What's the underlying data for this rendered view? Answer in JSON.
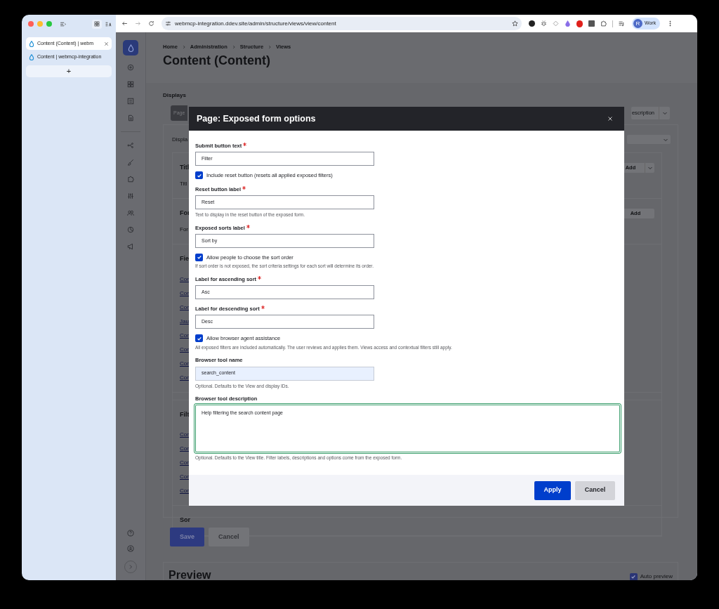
{
  "browser": {
    "tabs": [
      {
        "title": "Content (Content) | webm",
        "selected": true
      },
      {
        "title": "Content | webmcp-integration",
        "selected": false
      }
    ],
    "new_tab": "+",
    "url": "webmcp-integration.ddev.site/admin/structure/views/view/content",
    "profile": {
      "initial": "R",
      "name": "Work"
    }
  },
  "page": {
    "breadcrumb": [
      "Home",
      "Administration",
      "Structure",
      "Views"
    ],
    "title": "Content (Content)",
    "displays_label": "Displays",
    "display_tab": "Page",
    "description_button": "escription",
    "display_label": "Displa",
    "sections": [
      {
        "heading": "Titl",
        "lines": [
          "Titl"
        ],
        "button": {
          "label": "Add",
          "dropdown": true
        }
      },
      {
        "heading": "For",
        "lines": [
          "For"
        ],
        "button": {
          "label": "Add",
          "dropdown": false
        }
      },
      {
        "heading": "Fie",
        "links": [
          "Con",
          "Con",
          "Con",
          "Jau",
          "Con",
          "Con",
          "Con",
          "Con"
        ]
      },
      {
        "heading": "Filt",
        "links": [
          "Con",
          "Con",
          "Con",
          "Con",
          "Con"
        ]
      },
      {
        "heading": "Sor"
      }
    ],
    "buttons": [
      {
        "label": "Save",
        "kind": "primary"
      },
      {
        "label": "Cancel",
        "kind": "secondary"
      }
    ],
    "preview": "Preview",
    "auto_preview": {
      "label": "Auto preview",
      "checked": true
    }
  },
  "dialog": {
    "title": "Page: Exposed form options",
    "fields": [
      {
        "kind": "text",
        "label": "Submit button text",
        "required": true,
        "value": "Filter"
      },
      {
        "kind": "checkbox",
        "label": "Include reset button (resets all applied exposed filters)",
        "checked": true
      },
      {
        "kind": "text",
        "label": "Reset button label",
        "required": true,
        "value": "Reset",
        "description": "Text to display in the reset button of the exposed form."
      },
      {
        "kind": "text",
        "label": "Exposed sorts label",
        "required": true,
        "value": "Sort by"
      },
      {
        "kind": "checkbox",
        "label": "Allow people to choose the sort order",
        "checked": true,
        "description": "If sort order is not exposed, the sort criteria settings for each sort will determine its order."
      },
      {
        "kind": "text",
        "label": "Label for ascending sort",
        "required": true,
        "value": "Asc"
      },
      {
        "kind": "text",
        "label": "Label for descending sort",
        "required": true,
        "value": "Desc"
      },
      {
        "kind": "checkbox",
        "label": "Allow browser agent assistance",
        "checked": true,
        "description": "All exposed filters are included automatically. The user reviews and applies them. Views access and contextual filters still apply."
      },
      {
        "kind": "text",
        "label": "Browser tool name",
        "required": false,
        "value": "search_content",
        "autofilled": true,
        "description": "Optional. Defaults to the View and display IDs."
      },
      {
        "kind": "textarea",
        "label": "Browser tool description",
        "required": false,
        "value": "Help filtering the search content page",
        "focused": true,
        "description": "Optional. Defaults to the View title. Filter labels, descriptions and options come from the exposed form."
      }
    ],
    "buttons": [
      {
        "label": "Apply",
        "kind": "primary"
      },
      {
        "label": "Cancel",
        "kind": "secondary"
      }
    ]
  }
}
